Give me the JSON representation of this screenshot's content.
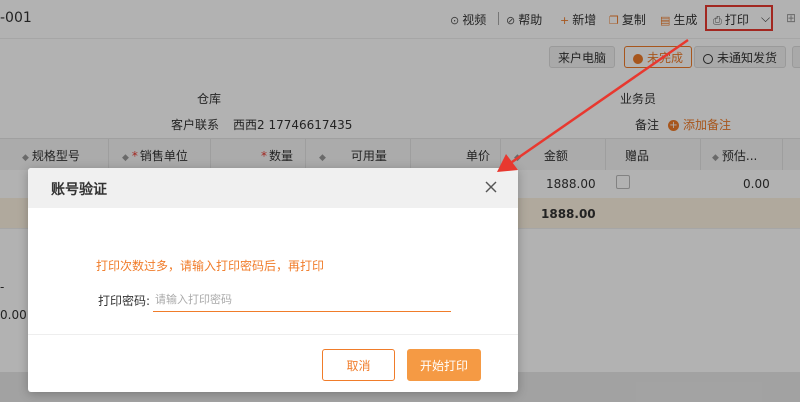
{
  "header": {
    "doc_id_fragment": "-001",
    "toolbar": {
      "video": "视频",
      "help": "帮助",
      "add": "新增",
      "copy": "复制",
      "generate": "生成",
      "print": "打印"
    }
  },
  "status_buttons": {
    "customer_call": "来户电脑",
    "completed": "未完成",
    "not_notified": "未通知发货"
  },
  "form": {
    "warehouse_label": "仓库",
    "customer_contact_label": "客户联系",
    "customer_contact_value": "西西2 17746617435",
    "salesperson_label": "业务员",
    "note_label": "备注",
    "add_note": "添加备注"
  },
  "table": {
    "columns": [
      "规格型号",
      "销售单位",
      "数量",
      "可用量",
      "单价",
      "金额",
      "赠品",
      "预估..."
    ],
    "rows": [
      {
        "amount": "1888.00",
        "estimate": "0.00"
      }
    ],
    "total": {
      "amount": "1888.00"
    },
    "left_fragment": "0.00",
    "left_dash": "-"
  },
  "modal": {
    "title": "账号验证",
    "message": "打印次数过多，请输入打印密码后，再打印",
    "password_label": "打印密码:",
    "password_placeholder": "请输入打印密码",
    "cancel": "取消",
    "confirm": "开始打印"
  },
  "colors": {
    "accent": "#f07c2a",
    "annotation": "#e8382f"
  }
}
